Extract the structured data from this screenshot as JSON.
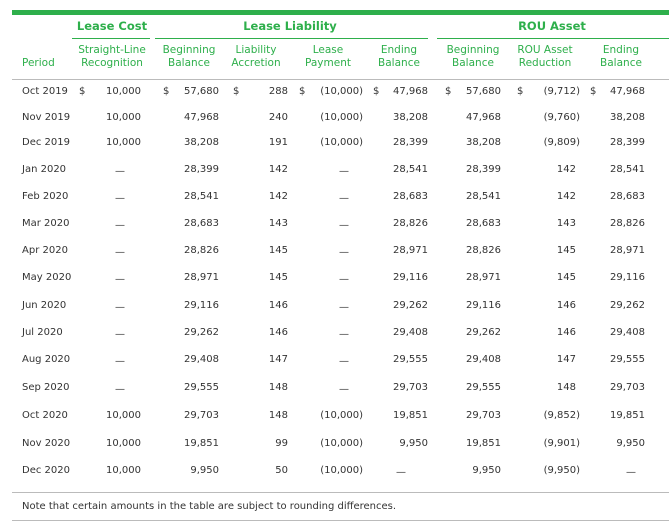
{
  "colors": {
    "accent": "#2eaf4b",
    "text": "#333333",
    "rule": "#bbbbbb"
  },
  "groups": {
    "lease_cost": "Lease Cost",
    "lease_liability": "Lease Liability",
    "rou_asset": "ROU Asset"
  },
  "headers": {
    "period": "Period",
    "straight_line": [
      "Straight-Line",
      "Recognition"
    ],
    "liab_beginning": [
      "Beginning",
      "Balance"
    ],
    "liab_accretion": [
      "Liability",
      "Accretion"
    ],
    "lease_payment": [
      "Lease",
      "Payment"
    ],
    "liab_ending": [
      "Ending",
      "Balance"
    ],
    "rou_beginning": [
      "Beginning",
      "Balance"
    ],
    "rou_reduction": [
      "ROU Asset",
      "Reduction"
    ],
    "rou_ending": [
      "Ending",
      "Balance"
    ]
  },
  "currency_symbol": "$",
  "rows": [
    {
      "period": "Oct 2019",
      "straight_line": "10,000",
      "liab_beginning": "57,680",
      "liab_accretion": "288",
      "lease_payment": "(10,000)",
      "liab_ending": "47,968",
      "rou_beginning": "57,680",
      "rou_reduction": "(9,712)",
      "rou_ending": "47,968"
    },
    {
      "period": "Nov 2019",
      "straight_line": "10,000",
      "liab_beginning": "47,968",
      "liab_accretion": "240",
      "lease_payment": "(10,000)",
      "liab_ending": "38,208",
      "rou_beginning": "47,968",
      "rou_reduction": "(9,760)",
      "rou_ending": "38,208"
    },
    {
      "period": "Dec 2019",
      "straight_line": "10,000",
      "liab_beginning": "38,208",
      "liab_accretion": "191",
      "lease_payment": "(10,000)",
      "liab_ending": "28,399",
      "rou_beginning": "38,208",
      "rou_reduction": "(9,809)",
      "rou_ending": "28,399"
    },
    {
      "period": "Jan 2020",
      "straight_line": "—",
      "liab_beginning": "28,399",
      "liab_accretion": "142",
      "lease_payment": "—",
      "liab_ending": "28,541",
      "rou_beginning": "28,399",
      "rou_reduction": "142",
      "rou_ending": "28,541"
    },
    {
      "period": "Feb 2020",
      "straight_line": "—",
      "liab_beginning": "28,541",
      "liab_accretion": "142",
      "lease_payment": "—",
      "liab_ending": "28,683",
      "rou_beginning": "28,541",
      "rou_reduction": "142",
      "rou_ending": "28,683"
    },
    {
      "period": "Mar 2020",
      "straight_line": "—",
      "liab_beginning": "28,683",
      "liab_accretion": "143",
      "lease_payment": "—",
      "liab_ending": "28,826",
      "rou_beginning": "28,683",
      "rou_reduction": "143",
      "rou_ending": "28,826"
    },
    {
      "period": "Apr 2020",
      "straight_line": "—",
      "liab_beginning": "28,826",
      "liab_accretion": "145",
      "lease_payment": "—",
      "liab_ending": "28,971",
      "rou_beginning": "28,826",
      "rou_reduction": "145",
      "rou_ending": "28,971"
    },
    {
      "period": "May 2020",
      "straight_line": "—",
      "liab_beginning": "28,971",
      "liab_accretion": "145",
      "lease_payment": "—",
      "liab_ending": "29,116",
      "rou_beginning": "28,971",
      "rou_reduction": "145",
      "rou_ending": "29,116"
    },
    {
      "period": "Jun 2020",
      "straight_line": "—",
      "liab_beginning": "29,116",
      "liab_accretion": "146",
      "lease_payment": "—",
      "liab_ending": "29,262",
      "rou_beginning": "29,116",
      "rou_reduction": "146",
      "rou_ending": "29,262"
    },
    {
      "period": "Jul 2020",
      "straight_line": "—",
      "liab_beginning": "29,262",
      "liab_accretion": "146",
      "lease_payment": "—",
      "liab_ending": "29,408",
      "rou_beginning": "29,262",
      "rou_reduction": "146",
      "rou_ending": "29,408"
    },
    {
      "period": "Aug 2020",
      "straight_line": "—",
      "liab_beginning": "29,408",
      "liab_accretion": "147",
      "lease_payment": "—",
      "liab_ending": "29,555",
      "rou_beginning": "29,408",
      "rou_reduction": "147",
      "rou_ending": "29,555"
    },
    {
      "period": "Sep 2020",
      "straight_line": "—",
      "liab_beginning": "29,555",
      "liab_accretion": "148",
      "lease_payment": "—",
      "liab_ending": "29,703",
      "rou_beginning": "29,555",
      "rou_reduction": "148",
      "rou_ending": "29,703"
    },
    {
      "period": "Oct 2020",
      "straight_line": "10,000",
      "liab_beginning": "29,703",
      "liab_accretion": "148",
      "lease_payment": "(10,000)",
      "liab_ending": "19,851",
      "rou_beginning": "29,703",
      "rou_reduction": "(9,852)",
      "rou_ending": "19,851"
    },
    {
      "period": "Nov 2020",
      "straight_line": "10,000",
      "liab_beginning": "19,851",
      "liab_accretion": "99",
      "lease_payment": "(10,000)",
      "liab_ending": "9,950",
      "rou_beginning": "19,851",
      "rou_reduction": "(9,901)",
      "rou_ending": "9,950"
    },
    {
      "period": "Dec 2020",
      "straight_line": "10,000",
      "liab_beginning": "9,950",
      "liab_accretion": "50",
      "lease_payment": "(10,000)",
      "liab_ending": "—",
      "rou_beginning": "9,950",
      "rou_reduction": "(9,950)",
      "rou_ending": "—"
    }
  ],
  "note": "Note that certain amounts in the table are subject to rounding differences."
}
